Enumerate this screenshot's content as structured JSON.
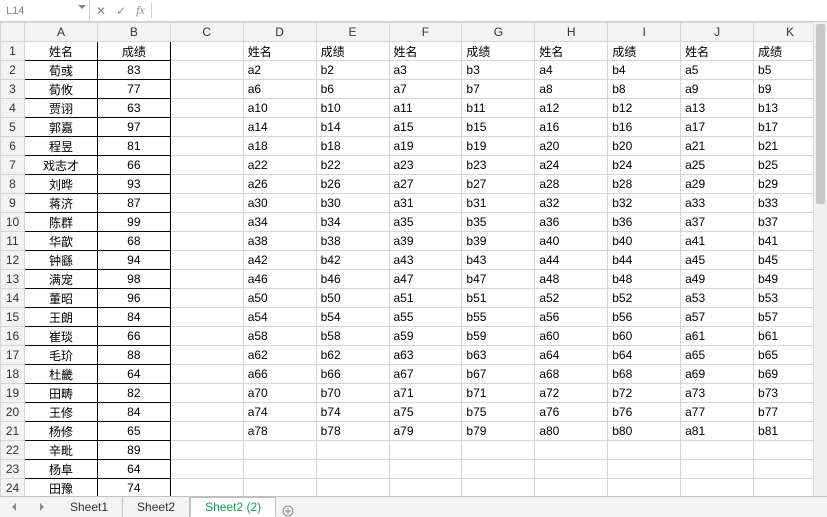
{
  "formula_bar": {
    "name_box": "L14",
    "fx_label": "fx",
    "cancel_glyph": "✕",
    "accept_glyph": "✓",
    "input": ""
  },
  "columns": [
    "A",
    "B",
    "C",
    "D",
    "E",
    "F",
    "G",
    "H",
    "I",
    "J",
    "K"
  ],
  "row_numbers": [
    1,
    2,
    3,
    4,
    5,
    6,
    7,
    8,
    9,
    10,
    11,
    12,
    13,
    14,
    15,
    16,
    17,
    18,
    19,
    20,
    21,
    22,
    23,
    24
  ],
  "ab_header": {
    "name": "姓名",
    "score": "成绩"
  },
  "ab_rows": [
    {
      "name": "荀彧",
      "score": 83
    },
    {
      "name": "荀攸",
      "score": 77
    },
    {
      "name": "贾诩",
      "score": 63
    },
    {
      "name": "郭嘉",
      "score": 97
    },
    {
      "name": "程昱",
      "score": 81
    },
    {
      "name": "戏志才",
      "score": 66
    },
    {
      "name": "刘晔",
      "score": 93
    },
    {
      "name": "蒋济",
      "score": 87
    },
    {
      "name": "陈群",
      "score": 99
    },
    {
      "name": "华歆",
      "score": 68
    },
    {
      "name": "钟繇",
      "score": 94
    },
    {
      "name": "满宠",
      "score": 98
    },
    {
      "name": "董昭",
      "score": 96
    },
    {
      "name": "王朗",
      "score": 84
    },
    {
      "name": "崔琰",
      "score": 66
    },
    {
      "name": "毛玠",
      "score": 88
    },
    {
      "name": "杜畿",
      "score": 64
    },
    {
      "name": "田畴",
      "score": 82
    },
    {
      "name": "王修",
      "score": 84
    },
    {
      "name": "杨修",
      "score": 65
    },
    {
      "name": "辛毗",
      "score": 89
    },
    {
      "name": "杨阜",
      "score": 64
    },
    {
      "name": "田豫",
      "score": 74
    }
  ],
  "right_header_labels": {
    "name": "姓名",
    "score": "成绩"
  },
  "right_rows": [
    [
      "a2",
      "b2",
      "a3",
      "b3",
      "a4",
      "b4",
      "a5",
      "b5"
    ],
    [
      "a6",
      "b6",
      "a7",
      "b7",
      "a8",
      "b8",
      "a9",
      "b9"
    ],
    [
      "a10",
      "b10",
      "a11",
      "b11",
      "a12",
      "b12",
      "a13",
      "b13"
    ],
    [
      "a14",
      "b14",
      "a15",
      "b15",
      "a16",
      "b16",
      "a17",
      "b17"
    ],
    [
      "a18",
      "b18",
      "a19",
      "b19",
      "a20",
      "b20",
      "a21",
      "b21"
    ],
    [
      "a22",
      "b22",
      "a23",
      "b23",
      "a24",
      "b24",
      "a25",
      "b25"
    ],
    [
      "a26",
      "b26",
      "a27",
      "b27",
      "a28",
      "b28",
      "a29",
      "b29"
    ],
    [
      "a30",
      "b30",
      "a31",
      "b31",
      "a32",
      "b32",
      "a33",
      "b33"
    ],
    [
      "a34",
      "b34",
      "a35",
      "b35",
      "a36",
      "b36",
      "a37",
      "b37"
    ],
    [
      "a38",
      "b38",
      "a39",
      "b39",
      "a40",
      "b40",
      "a41",
      "b41"
    ],
    [
      "a42",
      "b42",
      "a43",
      "b43",
      "a44",
      "b44",
      "a45",
      "b45"
    ],
    [
      "a46",
      "b46",
      "a47",
      "b47",
      "a48",
      "b48",
      "a49",
      "b49"
    ],
    [
      "a50",
      "b50",
      "a51",
      "b51",
      "a52",
      "b52",
      "a53",
      "b53"
    ],
    [
      "a54",
      "b54",
      "a55",
      "b55",
      "a56",
      "b56",
      "a57",
      "b57"
    ],
    [
      "a58",
      "b58",
      "a59",
      "b59",
      "a60",
      "b60",
      "a61",
      "b61"
    ],
    [
      "a62",
      "b62",
      "a63",
      "b63",
      "a64",
      "b64",
      "a65",
      "b65"
    ],
    [
      "a66",
      "b66",
      "a67",
      "b67",
      "a68",
      "b68",
      "a69",
      "b69"
    ],
    [
      "a70",
      "b70",
      "a71",
      "b71",
      "a72",
      "b72",
      "a73",
      "b73"
    ],
    [
      "a74",
      "b74",
      "a75",
      "b75",
      "a76",
      "b76",
      "a77",
      "b77"
    ],
    [
      "a78",
      "b78",
      "a79",
      "b79",
      "a80",
      "b80",
      "a81",
      "b81"
    ]
  ],
  "sheet_tabs": {
    "tabs": [
      "Sheet1",
      "Sheet2",
      "Sheet2 (2)"
    ],
    "active_index": 2
  }
}
